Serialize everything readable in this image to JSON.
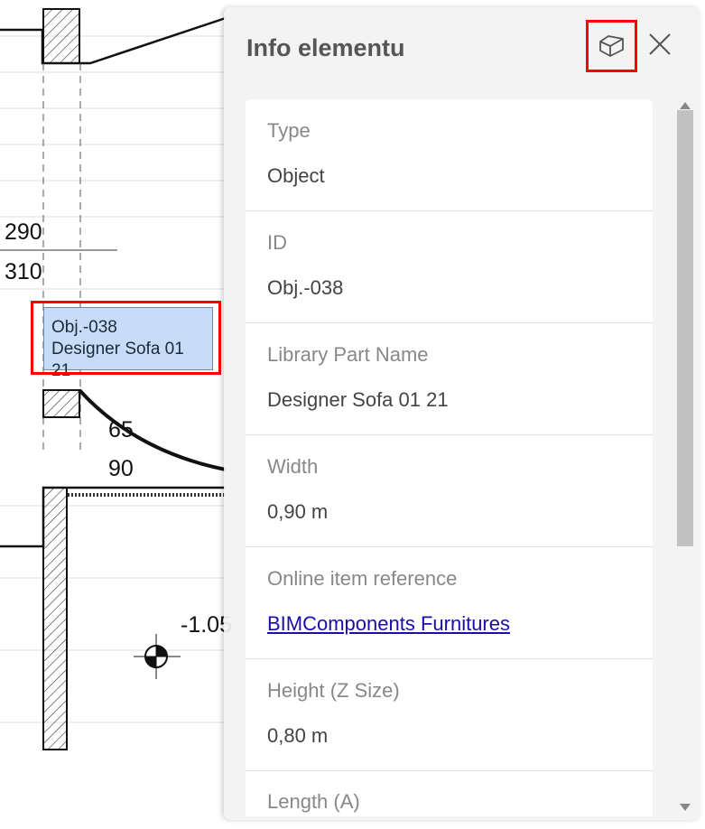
{
  "drawing": {
    "dims": [
      "290",
      "310",
      "65",
      "90",
      "-1.05"
    ],
    "tag": {
      "id": "Obj.-038",
      "name": "Designer Sofa 01 21"
    }
  },
  "panel": {
    "title": "Info elementu",
    "object_icon": "3d-object-icon",
    "close_icon": "close-icon",
    "rows": [
      {
        "label": "Type",
        "value": "Object"
      },
      {
        "label": "ID",
        "value": "Obj.-038"
      },
      {
        "label": "Library Part Name",
        "value": "Designer Sofa 01 21"
      },
      {
        "label": "Width",
        "value": "0,90 m"
      },
      {
        "label": "Online item reference",
        "value": "BIMComponents Furnitures"
      },
      {
        "label": "Height (Z Size)",
        "value": "0,80 m"
      },
      {
        "label": "Length (A)",
        "value": ""
      }
    ]
  }
}
